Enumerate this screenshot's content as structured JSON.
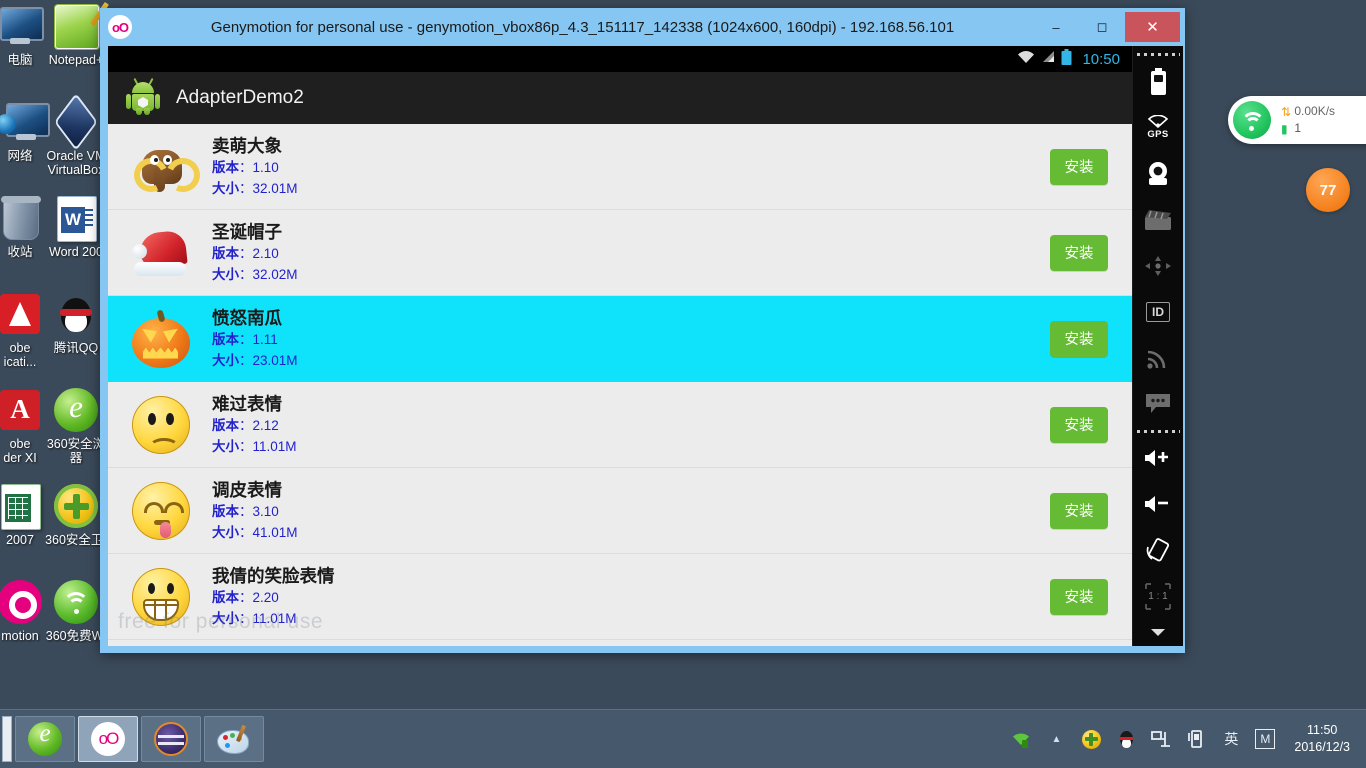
{
  "desktop": {
    "icons": [
      {
        "label": "电脑",
        "name": "my-computer",
        "art": "computer"
      },
      {
        "label": "网络",
        "name": "network",
        "art": "network"
      },
      {
        "label": "收站",
        "name": "recycle-bin",
        "art": "recycle"
      },
      {
        "label": "obe\nicati...",
        "name": "adobe-application",
        "art": "adobe"
      },
      {
        "label": "obe\nder XI",
        "name": "adobe-reader-xi",
        "art": "acrobat"
      },
      {
        "label": "2007",
        "name": "excel-2007",
        "art": "excel"
      },
      {
        "label": "motion",
        "name": "genymotion",
        "art": "genymotion"
      },
      {
        "label": "Notepad+",
        "name": "notepad-plus-plus",
        "art": "notepadpp"
      },
      {
        "label": "Oracle VM\nVirtualBox",
        "name": "oracle-vm-virtualbox",
        "art": "vbox"
      },
      {
        "label": "Word 200",
        "name": "word-2007",
        "art": "word"
      },
      {
        "label": "腾讯QQ",
        "name": "tencent-qq",
        "art": "qq"
      },
      {
        "label": "360安全浏\n器",
        "name": "360-browser",
        "art": "browser360"
      },
      {
        "label": "360安全卫:",
        "name": "360-security-guard",
        "art": "guard360"
      },
      {
        "label": "360免费Wi",
        "name": "360-free-wifi",
        "art": "wifi360"
      }
    ]
  },
  "wifi_widget": {
    "speed": "0.00K/s",
    "devices": "1",
    "badge": "77"
  },
  "window": {
    "title": "Genymotion for personal use - genymotion_vbox86p_4.3_151117_142338 (1024x600, 160dpi) - 192.168.56.101",
    "icon_text": "oO",
    "minimize": "‒",
    "maximize": "◻",
    "close": "✕"
  },
  "android": {
    "statusbar": {
      "clock": "10:50",
      "wifi_icon": "wifi-icon",
      "signal_icon": "cellular-signal-icon",
      "battery_icon": "battery-icon"
    },
    "actionbar": {
      "title": "AdapterDemo2",
      "icon": "android-robot-icon"
    },
    "watermark": "free for personal use",
    "install_label": "安装",
    "version_label": "版本",
    "size_label": "大小",
    "apps": [
      {
        "name": "卖萌大象",
        "version": "1.10",
        "size": "32.01M",
        "art": "elephant",
        "selected": false
      },
      {
        "name": "圣诞帽子",
        "version": "2.10",
        "size": "32.02M",
        "art": "santahat",
        "selected": false
      },
      {
        "name": "愤怒南瓜",
        "version": "1.11",
        "size": "23.01M",
        "art": "pumpkin",
        "selected": true
      },
      {
        "name": "难过表情",
        "version": "2.12",
        "size": "11.01M",
        "art": "sad",
        "selected": false
      },
      {
        "name": "调皮表情",
        "version": "3.10",
        "size": "41.01M",
        "art": "naughty",
        "selected": false
      },
      {
        "name": "我倩的笑脸表情",
        "version": "2.20",
        "size": "11.01M",
        "art": "grin",
        "selected": false
      }
    ]
  },
  "genymotion_tools": [
    {
      "name": "battery-widget-icon",
      "label": ""
    },
    {
      "name": "gps-icon",
      "label": "GPS"
    },
    {
      "name": "camera-icon",
      "label": ""
    },
    {
      "name": "video-recorder-icon",
      "label": ""
    },
    {
      "name": "dpad-icon",
      "label": ""
    },
    {
      "name": "identifiers-icon",
      "label": "ID"
    },
    {
      "name": "network-signal-icon",
      "label": ""
    },
    {
      "name": "sms-icon",
      "label": ""
    },
    {
      "name": "volume-up-icon",
      "label": ""
    },
    {
      "name": "volume-down-icon",
      "label": ""
    },
    {
      "name": "rotate-screen-icon",
      "label": ""
    },
    {
      "name": "scale-one-to-one-icon",
      "label": "1 : 1"
    },
    {
      "name": "more-chevron-icon",
      "label": ""
    }
  ],
  "taskbar": {
    "buttons": [
      {
        "name": "taskbar-360-browser",
        "art": "browser360",
        "active": false
      },
      {
        "name": "taskbar-genymotion",
        "art": "genymotion-oo",
        "active": true
      },
      {
        "name": "taskbar-eclipse",
        "art": "eclipse",
        "active": false
      },
      {
        "name": "taskbar-paint",
        "art": "paint",
        "active": false
      }
    ],
    "tray": [
      {
        "name": "tray-wifi-icon",
        "glyph": "wifi"
      },
      {
        "name": "tray-show-hidden-icon",
        "glyph": "▲"
      },
      {
        "name": "tray-360-guard-icon",
        "glyph": "guard"
      },
      {
        "name": "tray-qq-icon",
        "glyph": "qq"
      },
      {
        "name": "tray-network-icon",
        "glyph": "net"
      },
      {
        "name": "tray-battery-icon",
        "glyph": "batt"
      },
      {
        "name": "tray-ime-icon",
        "glyph": "英"
      },
      {
        "name": "tray-m-icon",
        "glyph": "M"
      }
    ],
    "time": "11:50",
    "date": "2016/12/3"
  },
  "colors": {
    "selection": "#0fe3fb",
    "install_green": "#66bb35",
    "meta_blue": "#2222cc",
    "title_bar": "#85c7f2",
    "close_red": "#c9545c",
    "android_accent": "#33b5e5"
  }
}
